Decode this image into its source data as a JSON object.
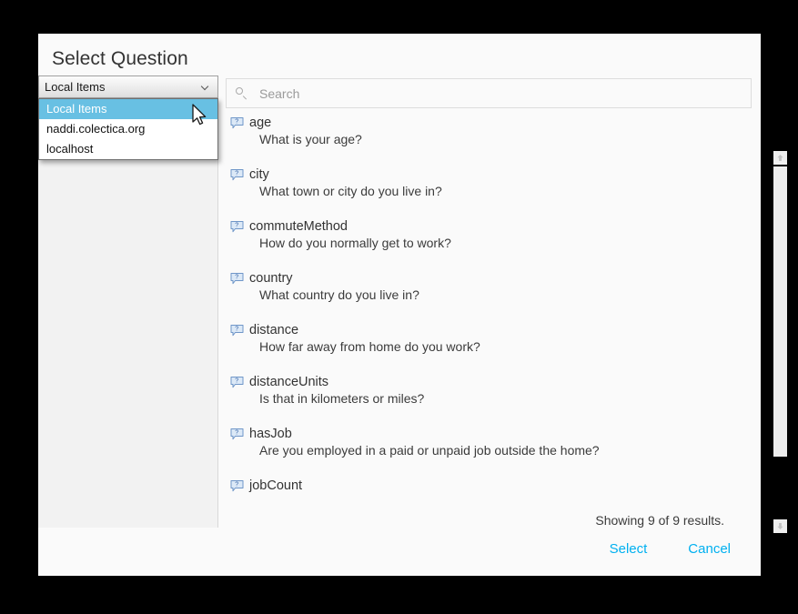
{
  "dialog": {
    "title": "Select Question"
  },
  "source_select": {
    "icon": "chevron-down-icon",
    "selected": "Local Items",
    "options": [
      {
        "label": "Local Items",
        "selected": true
      },
      {
        "label": "naddi.colectica.org",
        "selected": false
      },
      {
        "label": "localhost",
        "selected": false
      }
    ]
  },
  "search": {
    "icon": "search-icon",
    "value": "",
    "placeholder": "Search"
  },
  "question_list": {
    "item_icon": "question-bubble-icon",
    "items": [
      {
        "name": "age",
        "text": "What is your age?"
      },
      {
        "name": "city",
        "text": "What town or city do you live in?"
      },
      {
        "name": "commuteMethod",
        "text": "How do you normally get to work?"
      },
      {
        "name": "country",
        "text": "What country do you live in?"
      },
      {
        "name": "distance",
        "text": "How far away from home do you work?"
      },
      {
        "name": "distanceUnits",
        "text": "Is that in kilometers or miles?"
      },
      {
        "name": "hasJob",
        "text": "Are you employed in a paid or unpaid job outside the home?"
      },
      {
        "name": "jobCount",
        "text": ""
      }
    ]
  },
  "scrollbar": {
    "up_icon": "arrow-up-icon",
    "down_icon": "arrow-down-icon"
  },
  "footer": {
    "results": "Showing 9 of 9 results.",
    "select_label": "Select",
    "cancel_label": "Cancel"
  },
  "colors": {
    "accent": "#00b0f0",
    "highlight": "#68c0e3",
    "dialog_bg": "#fafafa",
    "panel_bg": "#f2f2f2",
    "backdrop": "#000000"
  }
}
